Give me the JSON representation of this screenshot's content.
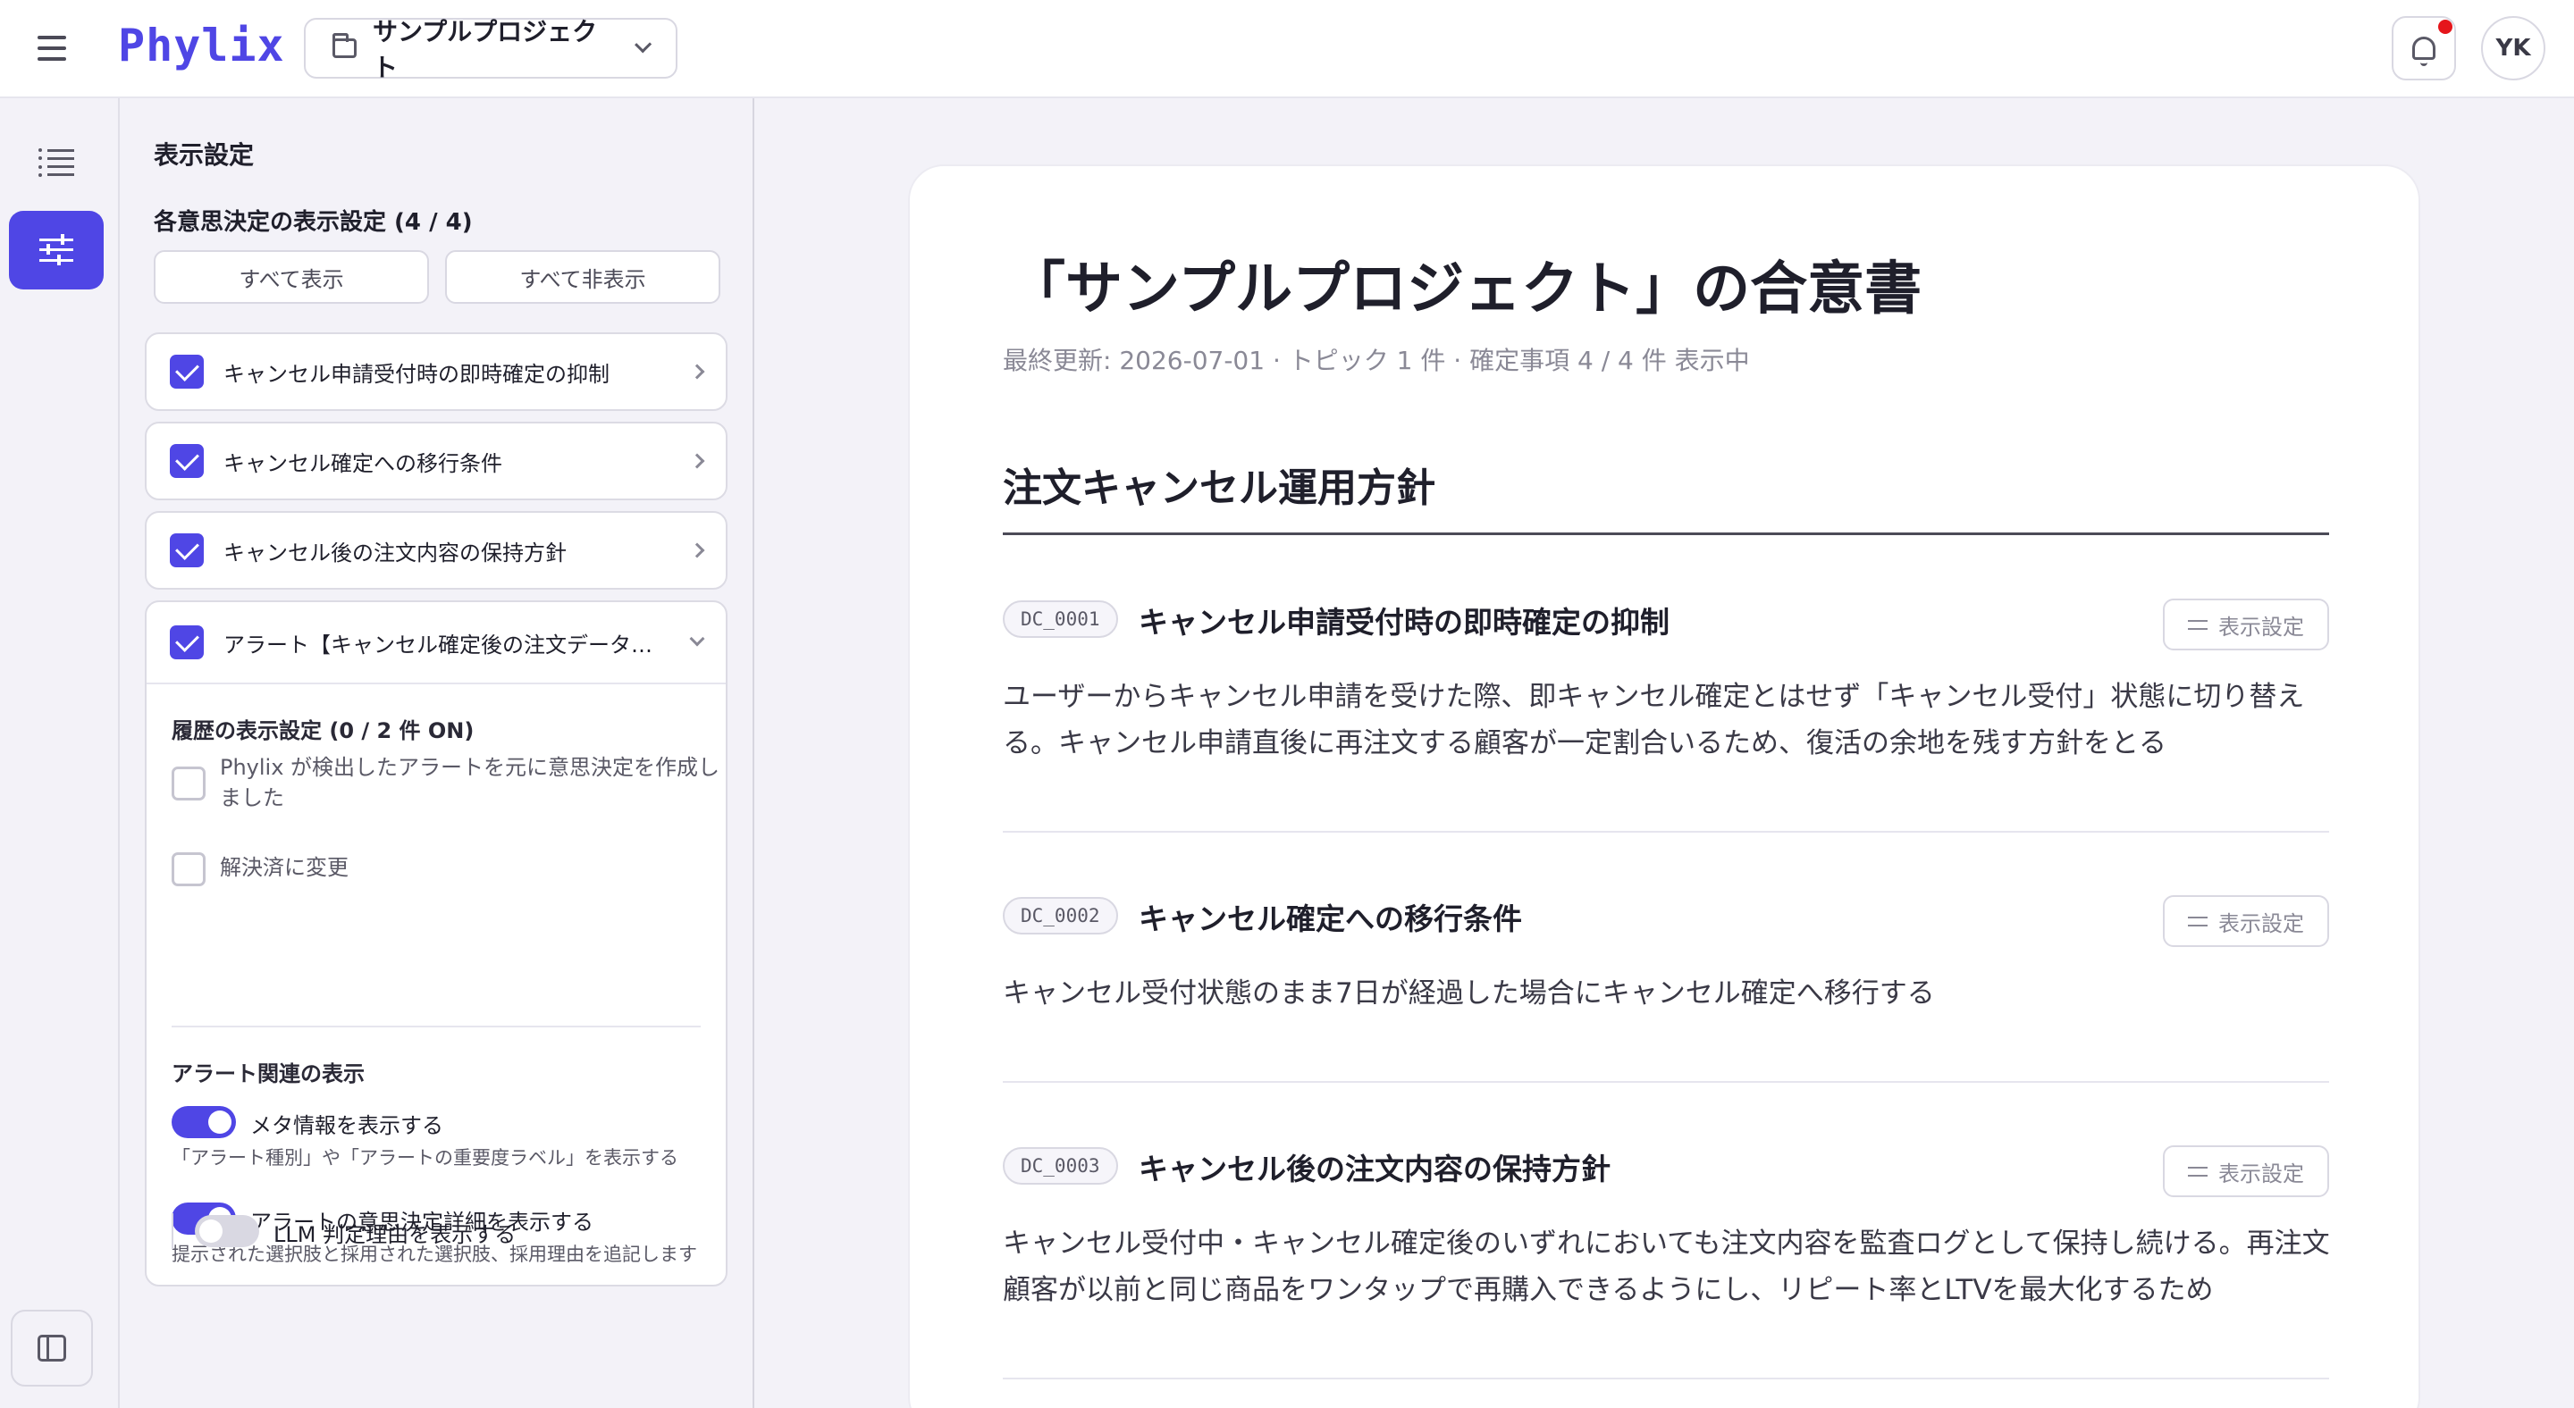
{
  "header": {
    "logo": "Phylix",
    "project_name": "サンプルプロジェクト",
    "avatar_initials": "YK"
  },
  "panel": {
    "title": "表示設定",
    "decisions_heading": "各意思決定の表示設定 (4 / 4)",
    "show_all": "すべて表示",
    "hide_all": "すべて非表示",
    "decisions": [
      {
        "label": "キャンセル申請受付時の即時確定の抑制",
        "checked": true
      },
      {
        "label": "キャンセル確定への移行条件",
        "checked": true
      },
      {
        "label": "キャンセル後の注文内容の保持方針",
        "checked": true
      },
      {
        "label": "アラート【キャンセル確定後の注文データ…",
        "checked": true
      }
    ],
    "alert_detail": {
      "history_heading": "履歴の表示設定 (0 / 2 件 ON)",
      "history_items": [
        {
          "label": "Phylix が検出したアラートを元に意思決定を作成しました",
          "checked": false
        },
        {
          "label": "解決済に変更",
          "checked": false
        }
      ],
      "alert_related_heading": "アラート関連の表示",
      "toggles": [
        {
          "label": "メタ情報を表示する",
          "desc": "「アラート種別」や「アラートの重要度ラベル」を表示する",
          "on": true
        },
        {
          "label": "アラートの意思決定詳細を表示する",
          "desc": "提示された選択肢と採用された選択肢、採用理由を追記します",
          "on": true
        },
        {
          "label": "LLM 判定理由を表示する",
          "desc": "",
          "on": false
        }
      ]
    }
  },
  "document": {
    "title": "「サンプルプロジェクト」の合意書",
    "meta": "最終更新: 2026-07-01 · トピック 1 件 · 確定事項 4 / 4 件 表示中",
    "section_title": "注文キャンセル運用方針",
    "display_settings_label": "表示設定",
    "decisions": [
      {
        "id": "DC_0001",
        "title": "キャンセル申請受付時の即時確定の抑制",
        "body": "ユーザーからキャンセル申請を受けた際、即キャンセル確定とはせず「キャンセル受付」状態に切り替える。キャンセル申請直後に再注文する顧客が一定割合いるため、復活の余地を残す方針をとる"
      },
      {
        "id": "DC_0002",
        "title": "キャンセル確定への移行条件",
        "body": "キャンセル受付状態のまま7日が経過した場合にキャンセル確定へ移行する"
      },
      {
        "id": "DC_0003",
        "title": "キャンセル後の注文内容の保持方針",
        "body": "キャンセル受付中・キャンセル確定後のいずれにおいても注文内容を監査ログとして保持し続ける。再注文顧客が以前と同じ商品をワンタップで再購入できるようにし、リピート率とLTVを最大化するため"
      }
    ]
  },
  "colors": {
    "accent": "#4f46e5",
    "notification": "#e5151b",
    "background": "#f3f2f8"
  },
  "icons": [
    "menu-icon",
    "folder-icon",
    "chevron-down-icon",
    "bell-icon",
    "list-icon",
    "sliders-icon",
    "sidebar-toggle-icon",
    "chevron-right-icon",
    "check-icon"
  ]
}
